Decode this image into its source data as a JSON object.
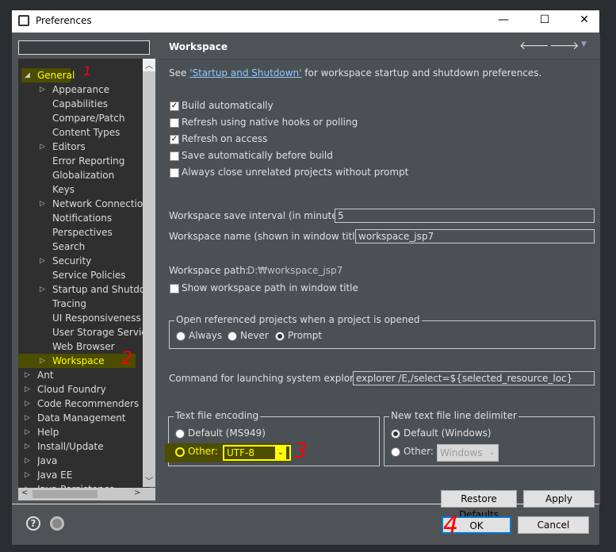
{
  "window": {
    "title": "Preferences",
    "minimize": "—",
    "maximize": "☐",
    "close": "✕"
  },
  "filter": {
    "value": "",
    "placeholder": ""
  },
  "tree": [
    {
      "label": "General",
      "level": 0,
      "expanded": true,
      "highlight": true
    },
    {
      "label": "Appearance",
      "level": 1,
      "arrow": true
    },
    {
      "label": "Capabilities",
      "level": 1
    },
    {
      "label": "Compare/Patch",
      "level": 1
    },
    {
      "label": "Content Types",
      "level": 1
    },
    {
      "label": "Editors",
      "level": 1,
      "arrow": true
    },
    {
      "label": "Error Reporting",
      "level": 1
    },
    {
      "label": "Globalization",
      "level": 1
    },
    {
      "label": "Keys",
      "level": 1
    },
    {
      "label": "Network Connections",
      "level": 1,
      "arrow": true
    },
    {
      "label": "Notifications",
      "level": 1
    },
    {
      "label": "Perspectives",
      "level": 1
    },
    {
      "label": "Search",
      "level": 1
    },
    {
      "label": "Security",
      "level": 1,
      "arrow": true
    },
    {
      "label": "Service Policies",
      "level": 1
    },
    {
      "label": "Startup and Shutdown",
      "level": 1,
      "arrow": true
    },
    {
      "label": "Tracing",
      "level": 1
    },
    {
      "label": "UI Responsiveness Monitoring",
      "level": 1
    },
    {
      "label": "User Storage Service",
      "level": 1
    },
    {
      "label": "Web Browser",
      "level": 1
    },
    {
      "label": "Workspace",
      "level": 1,
      "arrow": true,
      "highlight": true,
      "selected": true
    },
    {
      "label": "Ant",
      "level": 0,
      "arrow": true
    },
    {
      "label": "Cloud Foundry",
      "level": 0,
      "arrow": true
    },
    {
      "label": "Code Recommenders",
      "level": 0,
      "arrow": true
    },
    {
      "label": "Data Management",
      "level": 0,
      "arrow": true
    },
    {
      "label": "Help",
      "level": 0,
      "arrow": true
    },
    {
      "label": "Install/Update",
      "level": 0,
      "arrow": true
    },
    {
      "label": "Java",
      "level": 0,
      "arrow": true
    },
    {
      "label": "Java EE",
      "level": 0,
      "arrow": true
    },
    {
      "label": "Java Persistence",
      "level": 0,
      "arrow": true
    }
  ],
  "page": {
    "title": "Workspace",
    "intro_prefix": "See ",
    "intro_link": "'Startup and Shutdown'",
    "intro_suffix": " for workspace startup and shutdown preferences.",
    "checkboxes": [
      {
        "label": "Build automatically",
        "checked": true
      },
      {
        "label": "Refresh using native hooks or polling",
        "checked": false
      },
      {
        "label": "Refresh on access",
        "checked": true
      },
      {
        "label": "Save automatically before build",
        "checked": false
      },
      {
        "label": "Always close unrelated projects without prompt",
        "checked": false
      }
    ],
    "save_interval_label": "Workspace save interval (in minutes):",
    "save_interval_value": "5",
    "name_label": "Workspace name (shown in window title):",
    "name_value": "workspace_jsp7",
    "path_label": "Workspace path:",
    "path_value": "D:₩workspace_jsp7",
    "show_path_label": "Show workspace path in window title",
    "open_group": {
      "title": "Open referenced projects when a project is opened",
      "options": [
        "Always",
        "Never",
        "Prompt"
      ],
      "selected": "Prompt"
    },
    "explorer_label": "Command for launching system explorer:",
    "explorer_value": "explorer /E,/select=${selected_resource_loc}",
    "encoding": {
      "title": "Text file encoding",
      "default_label": "Default (MS949)",
      "other_label": "Other:",
      "other_value": "UTF-8",
      "selected": "Other"
    },
    "delimiter": {
      "title": "New text file line delimiter",
      "default_label": "Default (Windows)",
      "other_label": "Other:",
      "other_value": "Windows",
      "selected": "Default"
    },
    "restore_defaults": "Restore Defaults",
    "apply": "Apply"
  },
  "footer": {
    "ok": "OK",
    "cancel": "Cancel"
  },
  "annotations": [
    "1",
    "2",
    "3",
    "4"
  ],
  "colors": {
    "highlight": "#4d4d00",
    "highlight_text": "#ffff00",
    "annotation": "#ff0000",
    "link": "#8fc8ff"
  }
}
